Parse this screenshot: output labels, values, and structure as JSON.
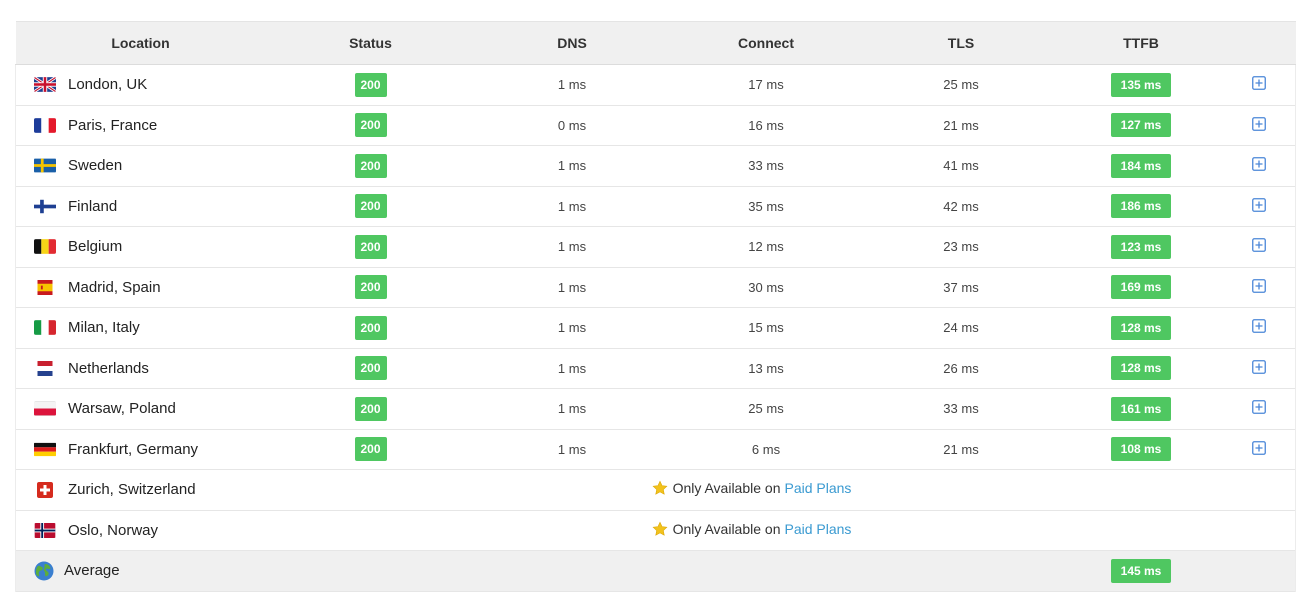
{
  "header": {
    "location": "Location",
    "status": "Status",
    "dns": "DNS",
    "connect": "Connect",
    "tls": "TLS",
    "ttfb": "TTFB"
  },
  "rows": [
    {
      "location": "London, UK",
      "flag": "uk-flag-icon",
      "status": "200",
      "dns": "1 ms",
      "connect": "17 ms",
      "tls": "25 ms",
      "ttfb": "135 ms"
    },
    {
      "location": "Paris, France",
      "flag": "france-flag-icon",
      "status": "200",
      "dns": "0 ms",
      "connect": "16 ms",
      "tls": "21 ms",
      "ttfb": "127 ms"
    },
    {
      "location": "Sweden",
      "flag": "sweden-flag-icon",
      "status": "200",
      "dns": "1 ms",
      "connect": "33 ms",
      "tls": "41 ms",
      "ttfb": "184 ms"
    },
    {
      "location": "Finland",
      "flag": "finland-flag-icon",
      "status": "200",
      "dns": "1 ms",
      "connect": "35 ms",
      "tls": "42 ms",
      "ttfb": "186 ms"
    },
    {
      "location": "Belgium",
      "flag": "belgium-flag-icon",
      "status": "200",
      "dns": "1 ms",
      "connect": "12 ms",
      "tls": "23 ms",
      "ttfb": "123 ms"
    },
    {
      "location": "Madrid, Spain",
      "flag": "spain-flag-icon",
      "status": "200",
      "dns": "1 ms",
      "connect": "30 ms",
      "tls": "37 ms",
      "ttfb": "169 ms"
    },
    {
      "location": "Milan, Italy",
      "flag": "italy-flag-icon",
      "status": "200",
      "dns": "1 ms",
      "connect": "15 ms",
      "tls": "24 ms",
      "ttfb": "128 ms"
    },
    {
      "location": "Netherlands",
      "flag": "netherlands-flag-icon",
      "status": "200",
      "dns": "1 ms",
      "connect": "13 ms",
      "tls": "26 ms",
      "ttfb": "128 ms"
    },
    {
      "location": "Warsaw, Poland",
      "flag": "poland-flag-icon",
      "status": "200",
      "dns": "1 ms",
      "connect": "25 ms",
      "tls": "33 ms",
      "ttfb": "161 ms"
    },
    {
      "location": "Frankfurt, Germany",
      "flag": "germany-flag-icon",
      "status": "200",
      "dns": "1 ms",
      "connect": "6 ms",
      "tls": "21 ms",
      "ttfb": "108 ms"
    }
  ],
  "locked_rows": [
    {
      "location": "Zurich, Switzerland",
      "flag": "switzerland-flag-icon",
      "notice": "Only Available on",
      "link": "Paid Plans"
    },
    {
      "location": "Oslo, Norway",
      "flag": "norway-flag-icon",
      "notice": "Only Available on",
      "link": "Paid Plans"
    }
  ],
  "average": {
    "label": "Average",
    "icon": "globe-icon",
    "ttfb": "145 ms"
  },
  "colors": {
    "badge_green": "#4fc761",
    "link_blue": "#3a9ad1",
    "plus_blue": "#4a86d8",
    "star_gold": "#f2c21c"
  }
}
